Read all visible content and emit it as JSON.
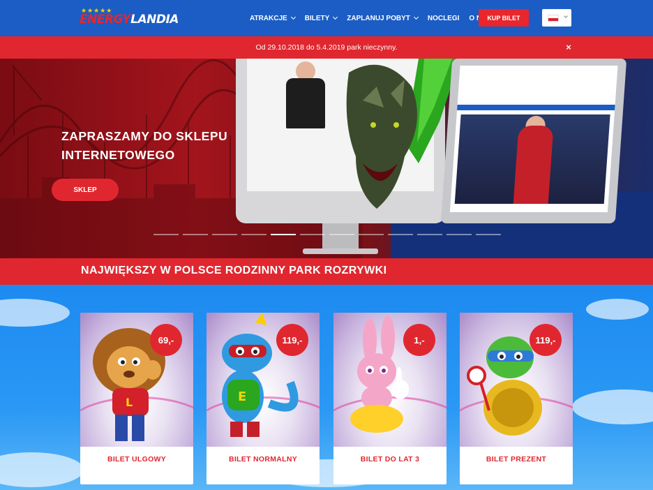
{
  "header": {
    "logo": {
      "part1": "ENERGY",
      "part2": "LANDIA",
      "stars": "★★★★★"
    },
    "nav": [
      {
        "label": "ATRAKCJE",
        "has_dropdown": true
      },
      {
        "label": "BILETY",
        "has_dropdown": true
      },
      {
        "label": "ZAPLANUJ POBYT",
        "has_dropdown": true
      },
      {
        "label": "NOCLEGI",
        "has_dropdown": false
      },
      {
        "label": "O NAS",
        "has_dropdown": true
      }
    ],
    "buy_button": "KUP BILET",
    "language": "pl-flag-icon"
  },
  "notice": {
    "text": "Od 29.10.2018 do 5.4.2019 park nieczynny.",
    "close_symbol": "×"
  },
  "hero": {
    "title_line1": "ZAPRASZAMY DO SKLEPU",
    "title_line2": "INTERNETOWEGO",
    "button": "SKLEP",
    "slides_count": 12,
    "active_slide": 5
  },
  "section": {
    "title": "NAJWIĘKSZY W POLSCE RODZINNY PARK ROZRYWKI"
  },
  "tickets": [
    {
      "price": "69,-",
      "label": "BILET ULGOWY",
      "mascot": "lion-mascot-icon"
    },
    {
      "price": "119,-",
      "label": "BILET NORMALNY",
      "mascot": "dragon-mascot-icon"
    },
    {
      "price": "1,-",
      "label": "BILET DO LAT 3",
      "mascot": "bunny-mascot-icon"
    },
    {
      "price": "119,-",
      "label": "BILET PREZENT",
      "mascot": "turtle-mascot-icon"
    }
  ],
  "colors": {
    "header_blue": "#1b5dc4",
    "brand_red": "#e0272f",
    "sky_blue": "#1e8cf0"
  }
}
